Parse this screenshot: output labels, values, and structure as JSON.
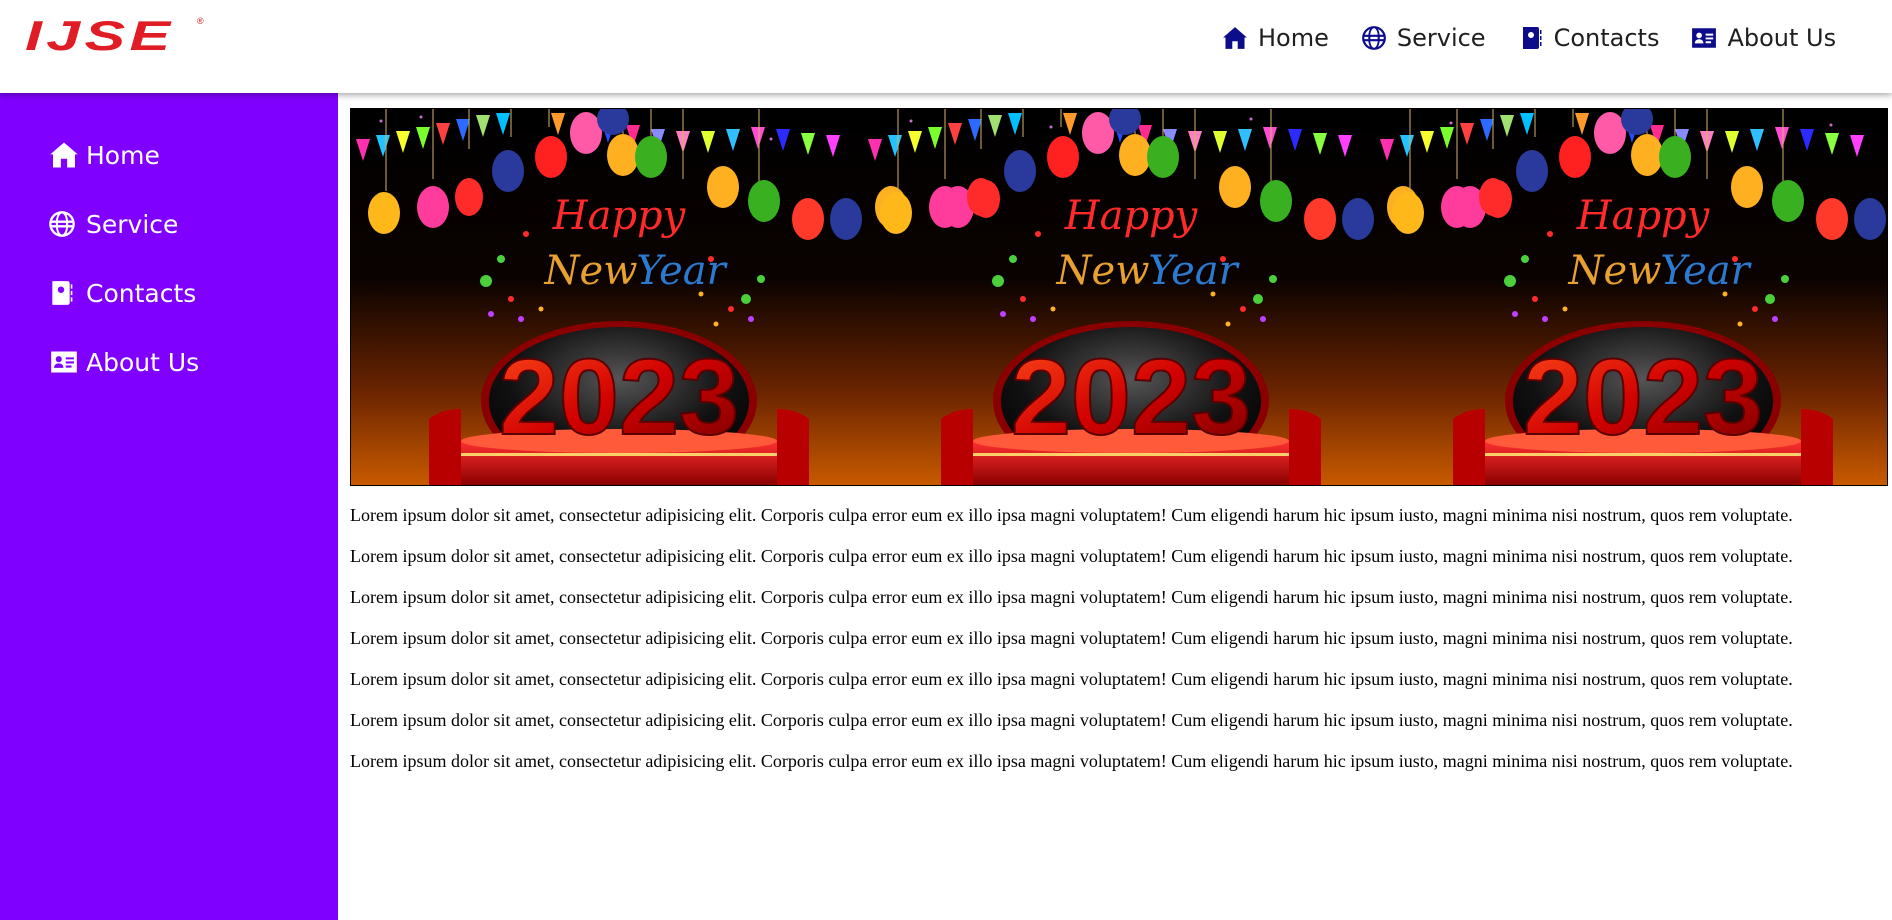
{
  "logo": {
    "text": "IJSE",
    "registered": "®"
  },
  "topnav": {
    "items": [
      {
        "label": "Home",
        "icon": "house-icon"
      },
      {
        "label": "Service",
        "icon": "globe-icon"
      },
      {
        "label": "Contacts",
        "icon": "address-book-icon"
      },
      {
        "label": "About Us",
        "icon": "id-card-icon"
      }
    ]
  },
  "sidebar": {
    "items": [
      {
        "label": "Home",
        "icon": "house-icon"
      },
      {
        "label": "Service",
        "icon": "globe-icon"
      },
      {
        "label": "Contacts",
        "icon": "address-book-icon"
      },
      {
        "label": "About Us",
        "icon": "id-card-icon"
      }
    ]
  },
  "banner": {
    "panels": [
      {
        "line1": "Happy",
        "line2a": "New",
        "line2b": "Year",
        "year": "2023"
      },
      {
        "line1": "Happy",
        "line2a": "New",
        "line2b": "Year",
        "year": "2023"
      },
      {
        "line1": "Happy",
        "line2a": "New",
        "line2b": "Year",
        "year": "2023"
      }
    ]
  },
  "content": {
    "paragraphs": [
      "Lorem ipsum dolor sit amet, consectetur adipisicing elit. Corporis culpa error eum ex illo ipsa magni voluptatem! Cum eligendi harum hic ipsum iusto, magni minima nisi nostrum, quos rem voluptate.",
      "Lorem ipsum dolor sit amet, consectetur adipisicing elit. Corporis culpa error eum ex illo ipsa magni voluptatem! Cum eligendi harum hic ipsum iusto, magni minima nisi nostrum, quos rem voluptate.",
      "Lorem ipsum dolor sit amet, consectetur adipisicing elit. Corporis culpa error eum ex illo ipsa magni voluptatem! Cum eligendi harum hic ipsum iusto, magni minima nisi nostrum, quos rem voluptate.",
      "Lorem ipsum dolor sit amet, consectetur adipisicing elit. Corporis culpa error eum ex illo ipsa magni voluptatem! Cum eligendi harum hic ipsum iusto, magni minima nisi nostrum, quos rem voluptate.",
      "Lorem ipsum dolor sit amet, consectetur adipisicing elit. Corporis culpa error eum ex illo ipsa magni voluptatem! Cum eligendi harum hic ipsum iusto, magni minima nisi nostrum, quos rem voluptate.",
      "Lorem ipsum dolor sit amet, consectetur adipisicing elit. Corporis culpa error eum ex illo ipsa magni voluptatem! Cum eligendi harum hic ipsum iusto, magni minima nisi nostrum, quos rem voluptate.",
      "Lorem ipsum dolor sit amet, consectetur adipisicing elit. Corporis culpa error eum ex illo ipsa magni voluptatem! Cum eligendi harum hic ipsum iusto, magni minima nisi nostrum, quos rem voluptate."
    ]
  },
  "colors": {
    "sidebar_bg": "#8000ff",
    "logo": "#e01c24",
    "topnav_icon": "#0d0d8c"
  }
}
